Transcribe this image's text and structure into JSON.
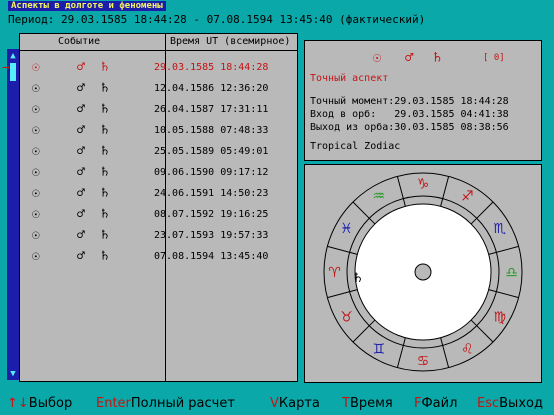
{
  "window": {
    "title": "Аспекты в долготе и феномены",
    "period": "Период: 29.03.1585 18:44:28 - 07.08.1594 13:45:40 (фактический)"
  },
  "table": {
    "col_event": "Событие",
    "col_time": "Время UT (всемирное)",
    "rows": [
      {
        "s1": "☉",
        "s2": "♂",
        "s3": "♄",
        "time": "29.03.1585 18:44:28"
      },
      {
        "s1": "☉",
        "s2": "♂",
        "s3": "♄",
        "time": "12.04.1586 12:36:20"
      },
      {
        "s1": "☉",
        "s2": "♂",
        "s3": "♄",
        "time": "26.04.1587 17:31:11"
      },
      {
        "s1": "☉",
        "s2": "♂",
        "s3": "♄",
        "time": "10.05.1588 07:48:33"
      },
      {
        "s1": "☉",
        "s2": "♂",
        "s3": "♄",
        "time": "25.05.1589 05:49:01"
      },
      {
        "s1": "☉",
        "s2": "♂",
        "s3": "♄",
        "time": "09.06.1590 09:17:12"
      },
      {
        "s1": "☉",
        "s2": "♂",
        "s3": "♄",
        "time": "24.06.1591 14:50:23"
      },
      {
        "s1": "☉",
        "s2": "♂",
        "s3": "♄",
        "time": "08.07.1592 19:16:25"
      },
      {
        "s1": "☉",
        "s2": "♂",
        "s3": "♄",
        "time": "23.07.1593 19:57:33"
      },
      {
        "s1": "☉",
        "s2": "♂",
        "s3": "♄",
        "time": "07.08.1594 13:45:40"
      }
    ]
  },
  "info": {
    "s1": "☉",
    "s2": "♂",
    "s3": "♄",
    "aspect_count": "[ 0]",
    "exact_aspect": "Точный аспект",
    "exact_moment": "Точный момент:29.03.1585 18:44:28",
    "orb_entry": "Вход в орб:   29.03.1585 04:41:38",
    "orb_exit": "Выход из орба:30.03.1585 08:38:56",
    "zodiac": "Tropical Zodiac"
  },
  "chart": {
    "signs": [
      "♈",
      "♉",
      "♊",
      "♋",
      "♌",
      "♍",
      "♎",
      "♏",
      "♐",
      "♑",
      "♒",
      "♓"
    ],
    "sign_colors": [
      "#c21515",
      "#c21515",
      "#1d1dac",
      "#c21515",
      "#c21515",
      "#c21515",
      "#1d9a1d",
      "#1d1dac",
      "#c21515",
      "#c21515",
      "#1d9a1d",
      "#1d1dac"
    ],
    "planet": "♄"
  },
  "footer": {
    "select_key": "↑↓",
    "select_label": "Выбор",
    "enter_key": "Enter",
    "enter_label": "Полный расчет",
    "v_key": "V",
    "v_label": "Карта",
    "t_key": "T",
    "t_label": "Время",
    "f_key": "F",
    "f_label": "Файл",
    "esc_key": "Esc",
    "esc_label": "Выход"
  }
}
